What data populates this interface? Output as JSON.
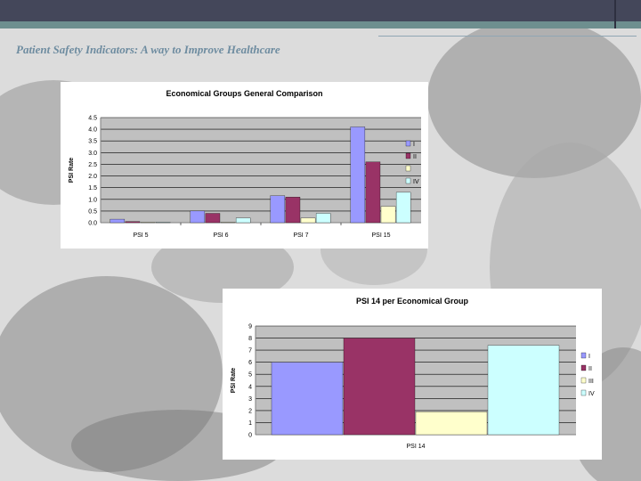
{
  "slide": {
    "title": "Patient Safety Indicators: A way to Improve Healthcare"
  },
  "colors": {
    "series": [
      "#9999ff",
      "#993366",
      "#ffffcc",
      "#ccffff"
    ],
    "plot_bg": "#c0c0c0",
    "topbar": "#44475a",
    "accent": "#6e8f8f",
    "title_text": "#6e8ca0"
  },
  "chart_data": [
    {
      "type": "bar",
      "title": "Economical Groups General Comparison",
      "ylabel": "PSI Rate",
      "xlabel": "",
      "categories": [
        "PSI 5",
        "PSI 6",
        "PSI 7",
        "PSI 15"
      ],
      "series": [
        {
          "name": "I",
          "values": [
            0.15,
            0.5,
            1.15,
            4.1
          ]
        },
        {
          "name": "II",
          "values": [
            0.05,
            0.4,
            1.1,
            2.6
          ]
        },
        {
          "name": "",
          "values": [
            0.02,
            0.02,
            0.2,
            0.7
          ]
        },
        {
          "name": "IV",
          "values": [
            0.02,
            0.2,
            0.4,
            1.3
          ]
        }
      ],
      "yticks": [
        "0.0",
        "0.5",
        "1.0",
        "1.5",
        "2.0",
        "2.5",
        "3.0",
        "3.5",
        "4.0",
        "4.5"
      ],
      "ylim": [
        0,
        4.5
      ],
      "grid": true,
      "legend": "right"
    },
    {
      "type": "bar",
      "title": "PSI 14 per Economical Group",
      "ylabel": "PSI Rate",
      "xlabel": "PSI 14",
      "categories": [
        "PSI 14"
      ],
      "series": [
        {
          "name": "I",
          "values": [
            6
          ]
        },
        {
          "name": "II",
          "values": [
            8
          ]
        },
        {
          "name": "III",
          "values": [
            1.9
          ]
        },
        {
          "name": "IV",
          "values": [
            7.4
          ]
        }
      ],
      "yticks": [
        "0",
        "1",
        "2",
        "3",
        "4",
        "5",
        "6",
        "7",
        "8",
        "9"
      ],
      "ylim": [
        0,
        9
      ],
      "grid": true,
      "legend": "right"
    }
  ]
}
